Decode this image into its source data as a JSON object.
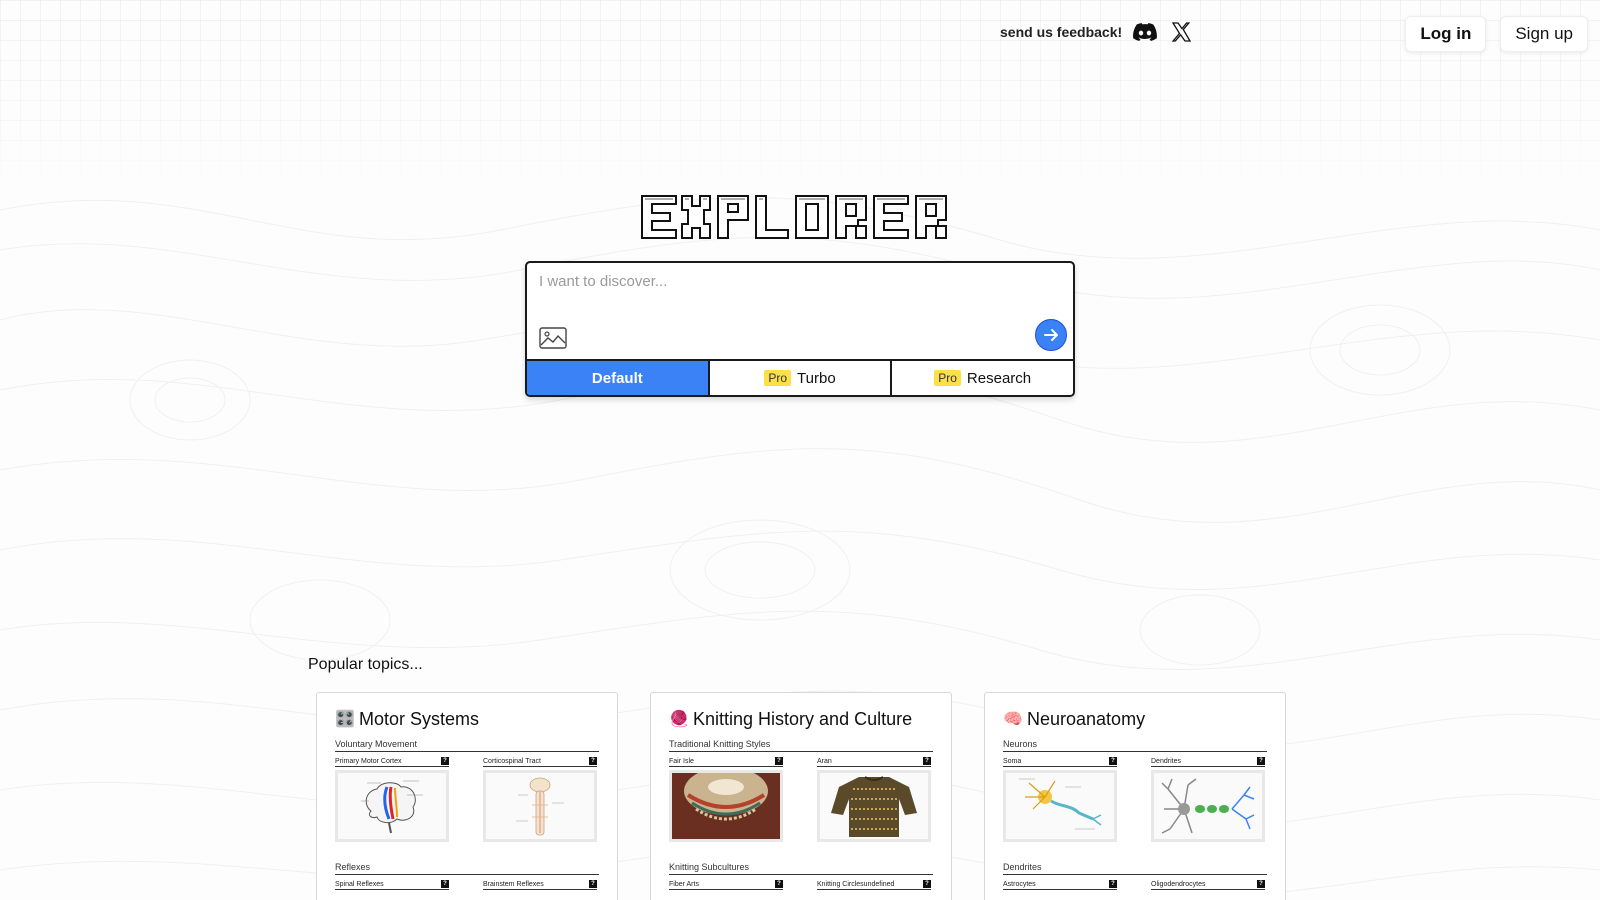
{
  "header": {
    "feedback_text": "send us feedback!",
    "discord_icon": "discord-icon",
    "x_icon": "x-logo-icon",
    "login_label": "Log in",
    "signup_label": "Sign up"
  },
  "logo": {
    "text": "EXPLORER"
  },
  "search": {
    "placeholder": "I want to discover...",
    "image_icon": "image-upload-icon",
    "submit_icon": "arrow-right-icon",
    "modes": [
      {
        "label": "Default",
        "pro": "",
        "active": true
      },
      {
        "label": "Turbo",
        "pro": "Pro",
        "active": false
      },
      {
        "label": "Research",
        "pro": "Pro",
        "active": false
      }
    ]
  },
  "popular": {
    "title": "Popular topics...",
    "cards": [
      {
        "emoji": "🎛️",
        "title": "Motor Systems",
        "sections": [
          {
            "title": "Voluntary Movement",
            "items": [
              "Primary Motor Cortex",
              "Corticospinal Tract"
            ]
          },
          {
            "title": "Reflexes",
            "items": [
              "Spinal Reflexes",
              "Brainstem Reflexes"
            ]
          }
        ]
      },
      {
        "emoji": "🧶",
        "title": "Knitting History and Culture",
        "sections": [
          {
            "title": "Traditional Knitting Styles",
            "items": [
              "Fair Isle",
              "Aran"
            ]
          },
          {
            "title": "Knitting Subcultures",
            "items": [
              "Fiber Arts",
              "Knitting Circlesundefined"
            ]
          }
        ]
      },
      {
        "emoji": "🧠",
        "title": "Neuroanatomy",
        "sections": [
          {
            "title": "Neurons",
            "items": [
              "Soma",
              "Dendrites"
            ]
          },
          {
            "title": "Dendrites",
            "items": [
              "Astrocytes",
              "Oligodendrocytes"
            ]
          }
        ]
      }
    ],
    "help_mark": "?"
  },
  "colors": {
    "accent": "#3b82f6",
    "pro_badge": "#fde047",
    "border": "#1a1a1a"
  }
}
